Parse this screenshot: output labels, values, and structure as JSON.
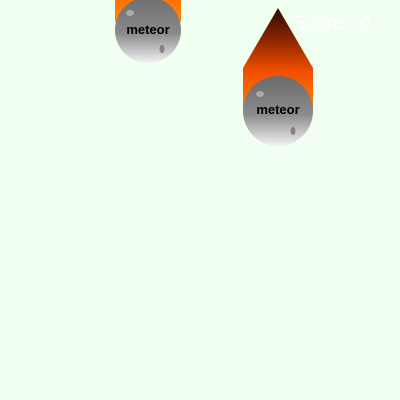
{
  "game": {
    "background_color": "#f0fff0",
    "meteors": [
      {
        "label": "meteor"
      },
      {
        "label": "meteor"
      }
    ],
    "score": {
      "label": "Score:",
      "value": "0",
      "color": "#ffffff"
    },
    "colors": {
      "flame_tip": "#2a0a00",
      "flame_mid": "#d24000",
      "flame_base": "#ff7a00",
      "rock_top": "#6e6e6e",
      "rock_bottom": "#f0f0f0"
    }
  }
}
